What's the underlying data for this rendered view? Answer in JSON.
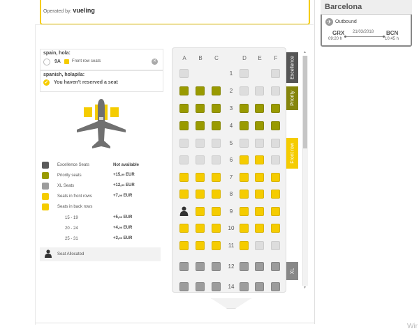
{
  "header": {
    "operated_prefix": "Operated by:",
    "operated_brand": "vueling"
  },
  "flight": {
    "destination_title": "Barcelona",
    "direction": "Outbound",
    "origin_code": "GRX",
    "destination_code": "BCN",
    "date": "21/03/2018",
    "departure_time": "09:20 h",
    "arrival_time": "10:45 h"
  },
  "passengers": [
    {
      "name": "spain, hola:",
      "seat": "9A",
      "seat_type": "Front row seats",
      "clear_icon": "close-icon"
    },
    {
      "name": "spanish, holapila:",
      "status": "You haven't reserved a seat"
    }
  ],
  "legend": {
    "items": [
      {
        "label": "Excellence Seats",
        "price_main": "Not available",
        "price_decimal": "",
        "currency": "",
        "color": "#5a5a5a"
      },
      {
        "label": "Priority seats",
        "price_main": "+15,",
        "price_decimal": "99",
        "currency": "EUR",
        "color": "#999a00"
      },
      {
        "label": "XL Seats",
        "price_main": "+12,",
        "price_decimal": "99",
        "currency": "EUR",
        "color": "#9c9c9c"
      },
      {
        "label": "Seats in front rows",
        "price_main": "+7,",
        "price_decimal": "99",
        "currency": "EUR",
        "color": "#f5cc00"
      },
      {
        "label": "Seats in back rows",
        "price_main": "",
        "price_decimal": "",
        "currency": "",
        "color": "#f5cc00"
      }
    ],
    "back_rows": [
      {
        "range": "15 - 19",
        "price_main": "+5,",
        "price_decimal": "99",
        "currency": "EUR"
      },
      {
        "range": "20 - 24",
        "price_main": "+4,",
        "price_decimal": "99",
        "currency": "EUR"
      },
      {
        "range": "25 - 31",
        "price_main": "+3,",
        "price_decimal": "99",
        "currency": "EUR"
      }
    ],
    "allocated_label": "Seat Allocated"
  },
  "cabin": {
    "columns": [
      "A",
      "B",
      "C",
      "D",
      "E",
      "F"
    ],
    "rows": [
      "1",
      "2",
      "3",
      "4",
      "5",
      "6",
      "7",
      "8",
      "9",
      "10",
      "11",
      "12",
      "14"
    ],
    "zones": [
      "Excellence",
      "Priority",
      "Front row",
      "XL"
    ],
    "colors": {
      "excellence": "#555555",
      "priority": "#85850c",
      "front": "#f5cc00",
      "xl": "#888888"
    }
  },
  "os_watermark": "Wir"
}
